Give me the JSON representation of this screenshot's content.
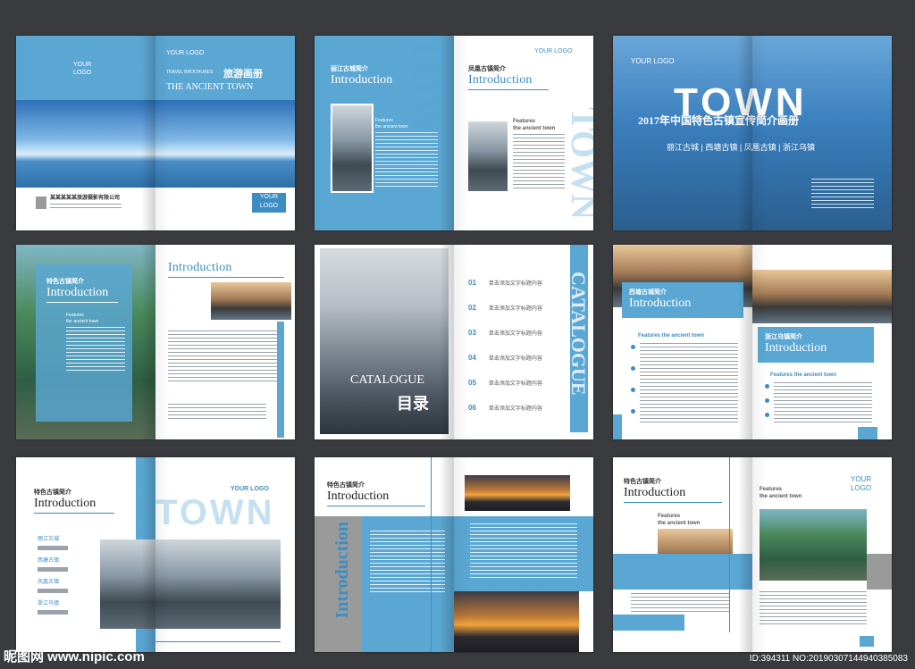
{
  "brochure": {
    "your_logo": "YOUR LOGO",
    "your_logo_stack_1": "YOUR",
    "your_logo_stack_2": "LOGO",
    "travel_brochures": "TRAVEL BROCHURES",
    "title_cn": "旅游画册",
    "title_en": "THE ANCIENT TOWN",
    "company": "某某某某某旅游摄影有限公司",
    "introduction": "Introduction",
    "features": "Features",
    "features_sub": "the ancient town",
    "town_word": "TOWN",
    "catalogue": "CATALOGUE",
    "catalogue_cn": "目录",
    "headline_2017": "2017年中国特色古镇宣传简介画册",
    "towns_line": "丽江古城 | 西塘古镇 | 凤凰古镇 | 浙江乌镇",
    "sp2_left_cn": "丽江古城简介",
    "sp2_right_cn": "凤凰古镇简介",
    "sp4_cn": "特色古镇简介",
    "sp6_left_cn": "西塘古城简介",
    "sp6_right_cn": "浙江乌镇简介",
    "features_line": "Features the ancient town",
    "sp7_cn": "特色古镇简介",
    "sp8_cn": "特色古镇简介",
    "sp9_cn": "特色古镇简介",
    "toc_numbers": [
      "01",
      "02",
      "03",
      "04",
      "05",
      "06"
    ],
    "toc_item": "单击添加文字标题内容",
    "town_list": [
      "丽江古城",
      "西塘古镇",
      "凤凰古镇",
      "浙江乌镇"
    ]
  },
  "watermark": {
    "site": "昵图网 www.nipic.com",
    "id": "ID:394311 NO:20190307144940385083"
  }
}
